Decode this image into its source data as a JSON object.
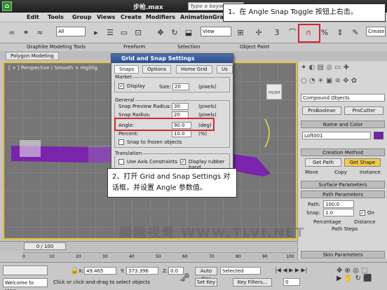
{
  "window": {
    "title": "步枪.max",
    "search_placeholder": "Type a keyw"
  },
  "menu": [
    "Edit",
    "Tools",
    "Group",
    "Views",
    "Create",
    "Modifiers",
    "Animation",
    "Graph"
  ],
  "toolbar": {
    "filter_value": "All",
    "ref_coord": "View",
    "create_selection": "Create"
  },
  "ribbon": {
    "items": [
      "Graphite Modeling Tools",
      "Freeform",
      "Selection",
      "Object Paint"
    ],
    "tab": "Polygon Modeling"
  },
  "viewport": {
    "label": "[ + ] Perspective | Smooth + Highlig",
    "viewcube_label": "FRONT"
  },
  "dialog": {
    "title": "Grid and Snap Settings",
    "tabs": [
      "Snaps",
      "Options",
      "Home Grid",
      "Us"
    ],
    "marker": {
      "title": "Marker",
      "display_label": "Display",
      "display_checked": true,
      "size_label": "Size:",
      "size_value": "20",
      "size_unit": "(pixels)"
    },
    "general": {
      "title": "General",
      "preview_label": "Snap Preview Radius:",
      "preview_value": "30",
      "preview_unit": "(pixels)",
      "radius_label": "Snap Radius:",
      "radius_value": "20",
      "radius_unit": "(pixels)",
      "angle_label": "Angle:",
      "angle_value": "90.0",
      "angle_unit": "(deg)",
      "percent_label": "Percent:",
      "percent_value": "10.0",
      "percent_unit": "(%)",
      "frozen_label": "Snap to frozen objects"
    },
    "translation": {
      "title": "Translation",
      "axis_label": "Use Axis Constraints",
      "rubber_label": "Display rubber band",
      "rubber_checked": true
    }
  },
  "callouts": {
    "one": "1、在 Angle Snap Toggle 按钮上右击。",
    "two": "2、打开 Grid and Snap Settings 对话框，并设置 Angle 参数值。"
  },
  "command_panel": {
    "category": "Compound Objects",
    "buttons": [
      "ProBoolean",
      "ProCutter"
    ],
    "name_color_title": "Name and Color",
    "object_name": "Loft001",
    "creation_title": "Creation Method",
    "get_path": "Get Path",
    "get_shape": "Get Shape",
    "move": "Move",
    "copy": "Copy",
    "instance": "Instance",
    "surface_title": "Surface Parameters",
    "path_title": "Path Parameters",
    "path_label": "Path:",
    "path_value": "100.0",
    "snap_label": "Snap:",
    "snap_value": "1.0",
    "on_label": "On",
    "percentage": "Percentage",
    "distance": "Distance",
    "path_steps": "Path Steps",
    "skin_title": "Skin Parameters"
  },
  "timeline": {
    "frame": "0 / 100",
    "ticks": [
      "0",
      "10",
      "20",
      "30",
      "40",
      "50",
      "60",
      "70",
      "80",
      "90",
      "100"
    ]
  },
  "status": {
    "welcome": "Welcome to MAX:",
    "prompt": "Click or click-and-drag to select objects",
    "x_label": "X:",
    "x_value": "49.465",
    "y_label": "Y:",
    "y_value": "373.396",
    "z_label": "Z:",
    "z_value": "0.0",
    "auto_key": "Auto Key",
    "selected": "Selected",
    "set_key": "Set Key",
    "key_filters": "Key Filters...",
    "frame_field": "0"
  },
  "watermark": "腾龍視覺 WWW.TLVI.NET",
  "colors": {
    "highlight": "#d8262b",
    "viewport_border": "#e8c13a",
    "object": "#7a1fb0"
  }
}
